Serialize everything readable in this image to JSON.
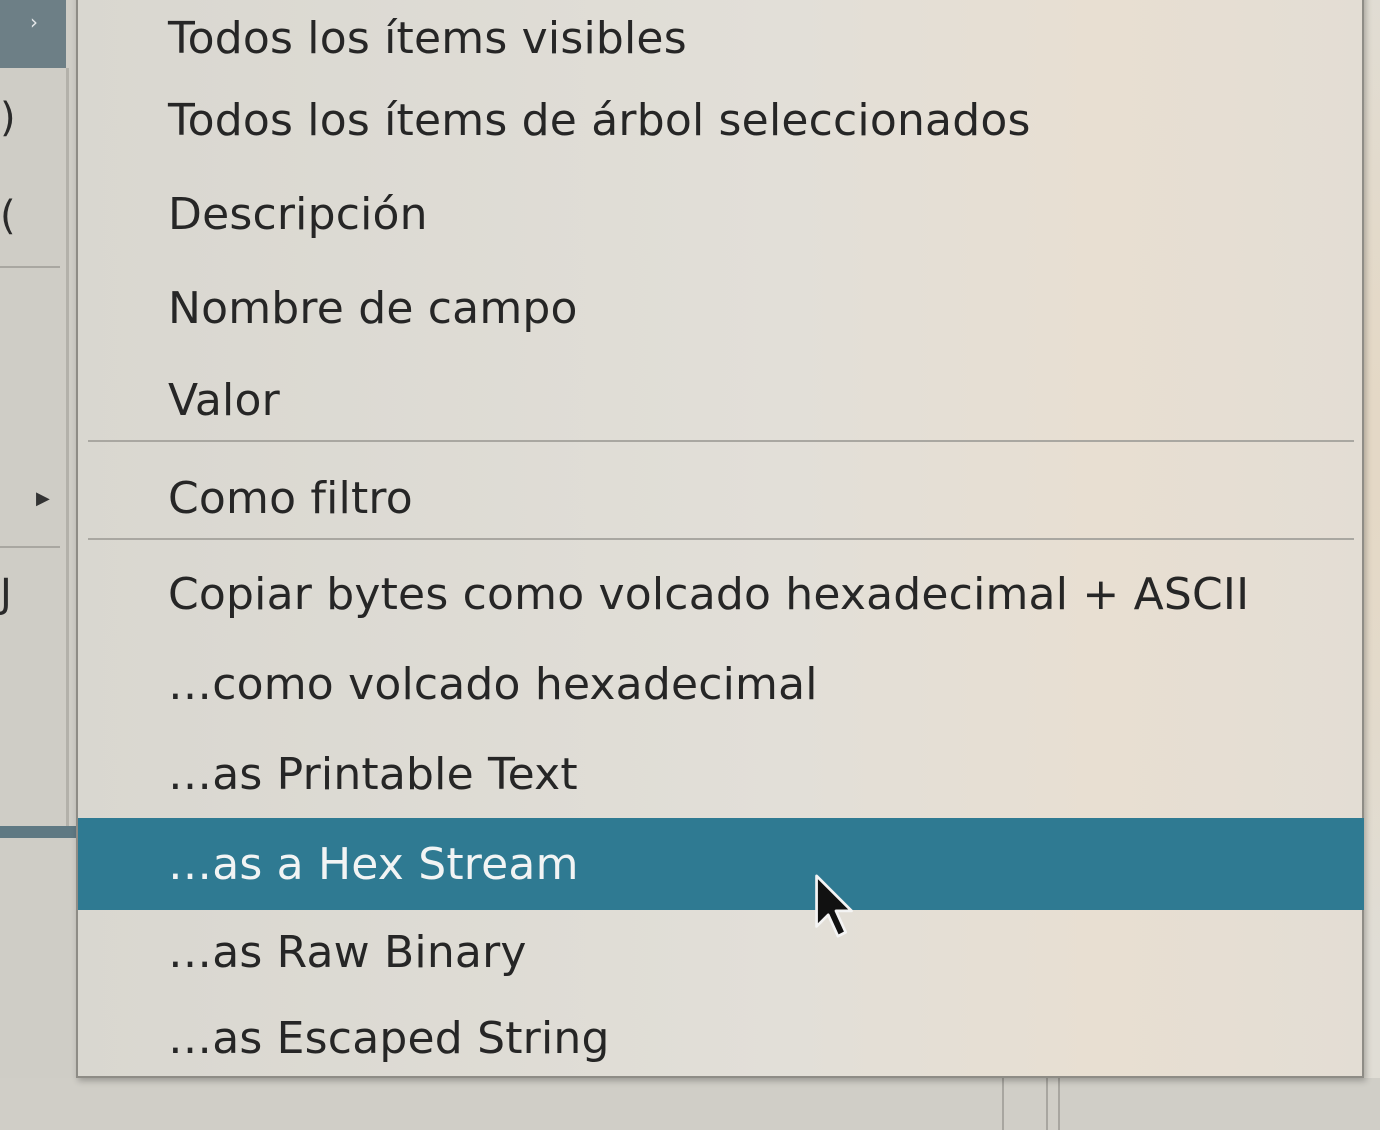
{
  "menu": {
    "items": [
      {
        "label": "Todos los ítems visibles"
      },
      {
        "label": "Todos los ítems de árbol seleccionados"
      },
      {
        "label": "Descripción"
      },
      {
        "label": "Nombre de campo"
      },
      {
        "label": "Valor"
      },
      {
        "label": "Como filtro"
      },
      {
        "label": "Copiar bytes como volcado hexadecimal + ASCII"
      },
      {
        "label": "…como volcado hexadecimal"
      },
      {
        "label": "…as Printable Text"
      },
      {
        "label": "…as a Hex Stream",
        "selected": true
      },
      {
        "label": "…as Raw Binary"
      },
      {
        "label": "…as Escaped String"
      }
    ]
  },
  "icons": {
    "left_header_arrow": "chevron-right-icon",
    "left_submenu_arrow": "triangle-right-icon",
    "cursor": "mouse-pointer-icon"
  },
  "colors": {
    "selection": "#2f7a92",
    "selection_text": "#f2f4f4",
    "menu_text": "#262626"
  }
}
